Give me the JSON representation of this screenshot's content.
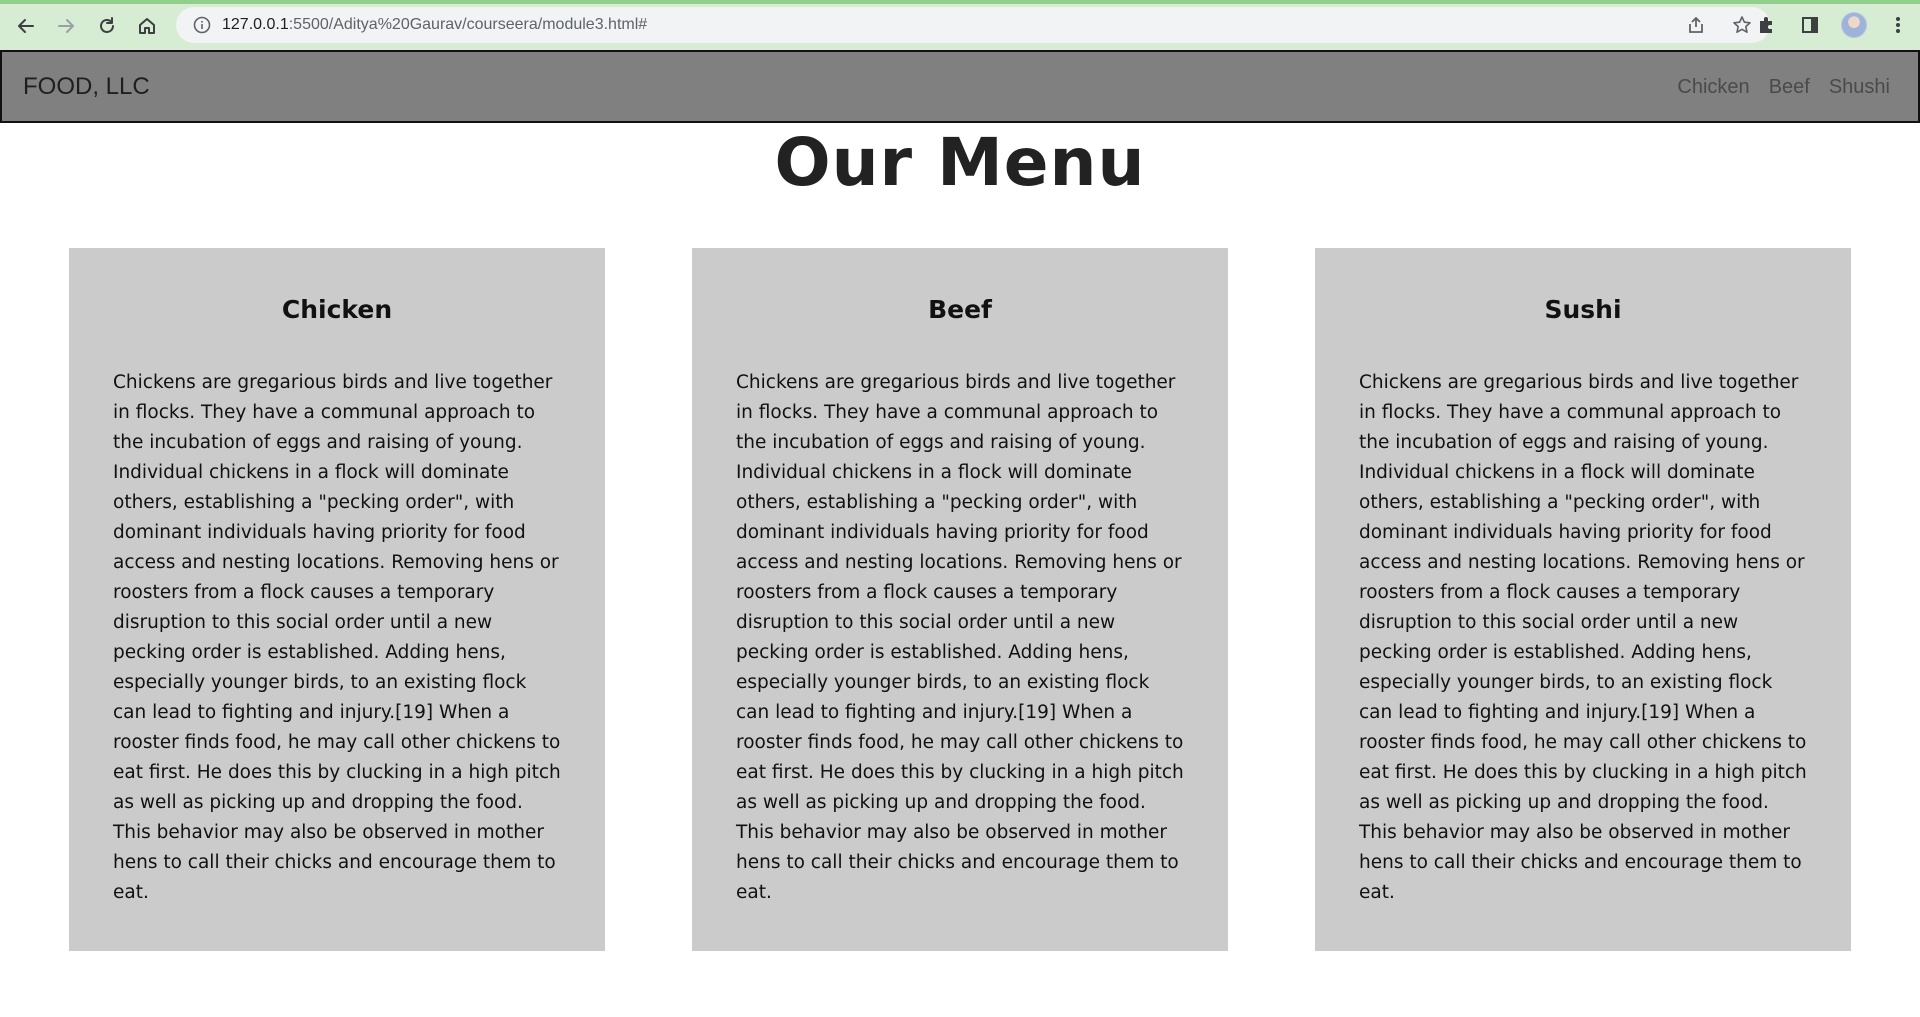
{
  "browser": {
    "url_host": "127.0.0.1",
    "url_path": ":5500/Aditya%20Gaurav/courseera/module3.html#"
  },
  "navbar": {
    "brand": "FOOD, LLC",
    "links": [
      "Chicken",
      "Beef",
      "Shushi"
    ]
  },
  "main": {
    "title": "Our Menu",
    "cards": [
      {
        "heading": "Chicken",
        "text": "Chickens are gregarious birds and live together in flocks. They have a communal approach to the incubation of eggs and raising of young. Individual chickens in a flock will dominate others, establishing a \"pecking order\", with dominant individuals having priority for food access and nesting locations. Removing hens or roosters from a flock causes a temporary disruption to this social order until a new pecking order is established. Adding hens, especially younger birds, to an existing flock can lead to fighting and injury.[19] When a rooster finds food, he may call other chickens to eat first. He does this by clucking in a high pitch as well as picking up and dropping the food. This behavior may also be observed in mother hens to call their chicks and encourage them to eat."
      },
      {
        "heading": "Beef",
        "text": "Chickens are gregarious birds and live together in flocks. They have a communal approach to the incubation of eggs and raising of young. Individual chickens in a flock will dominate others, establishing a \"pecking order\", with dominant individuals having priority for food access and nesting locations. Removing hens or roosters from a flock causes a temporary disruption to this social order until a new pecking order is established. Adding hens, especially younger birds, to an existing flock can lead to fighting and injury.[19] When a rooster finds food, he may call other chickens to eat first. He does this by clucking in a high pitch as well as picking up and dropping the food. This behavior may also be observed in mother hens to call their chicks and encourage them to eat."
      },
      {
        "heading": "Sushi",
        "text": "Chickens are gregarious birds and live together in flocks. They have a communal approach to the incubation of eggs and raising of young. Individual chickens in a flock will dominate others, establishing a \"pecking order\", with dominant individuals having priority for food access and nesting locations. Removing hens or roosters from a flock causes a temporary disruption to this social order until a new pecking order is established. Adding hens, especially younger birds, to an existing flock can lead to fighting and injury.[19] When a rooster finds food, he may call other chickens to eat first. He does this by clucking in a high pitch as well as picking up and dropping the food. This behavior may also be observed in mother hens to call their chicks and encourage them to eat."
      }
    ]
  },
  "colors": {
    "chrome_bg": "#d6ecd3",
    "navbar_bg": "#808080",
    "card_bg": "#cbcbcb"
  },
  "icons": {
    "back": "arrow-left-icon",
    "forward": "arrow-right-icon",
    "reload": "reload-icon",
    "home": "home-icon",
    "info": "info-icon",
    "share": "share-icon",
    "bookmark": "star-icon",
    "extensions": "puzzle-icon",
    "side_panel": "side-panel-icon",
    "menu": "kebab-menu-icon"
  }
}
